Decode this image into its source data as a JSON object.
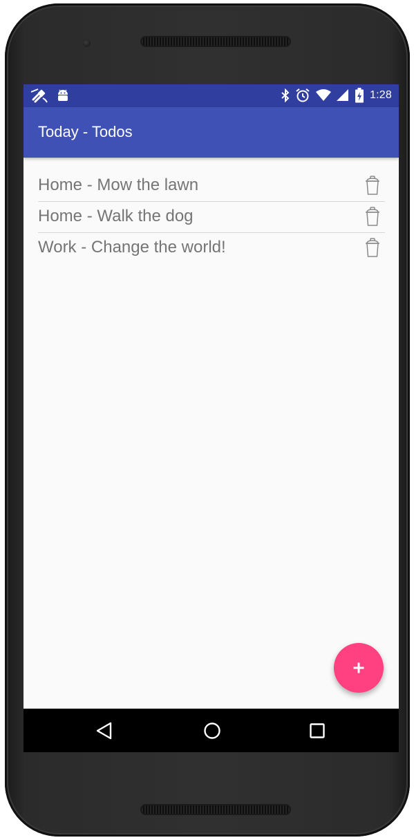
{
  "status_bar": {
    "time": "1:28",
    "background_color": "#303f9f",
    "left_icons": [
      "fake-gps-icon",
      "android-icon"
    ],
    "right_icons": [
      "bluetooth-icon",
      "alarm-icon",
      "wifi-icon",
      "cell-signal-icon",
      "battery-charging-icon"
    ]
  },
  "app_bar": {
    "title": "Today - Todos",
    "background_color": "#3f51b5"
  },
  "todos": [
    {
      "text": "Home - Mow the lawn",
      "action_icon": "trash-icon"
    },
    {
      "text": "Home - Walk the dog",
      "action_icon": "trash-icon"
    },
    {
      "text": "Work - Change the world!",
      "action_icon": "trash-icon"
    }
  ],
  "fab": {
    "icon": "plus-icon",
    "color": "#ff4081"
  },
  "nav_bar": {
    "buttons": [
      "back-icon",
      "home-icon",
      "recents-icon"
    ]
  }
}
